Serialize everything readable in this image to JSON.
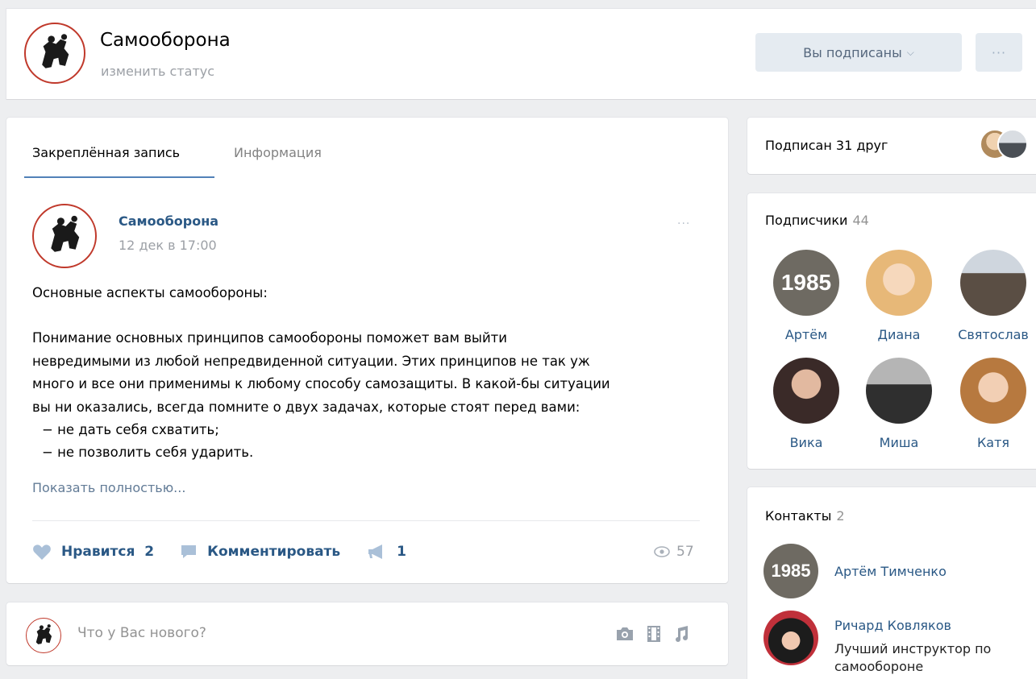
{
  "header": {
    "title": "Самооборона",
    "status": "изменить статус",
    "subscribed_label": "Вы подписаны",
    "more_label": "···"
  },
  "tabs": [
    {
      "label": "Закреплённая запись",
      "active": true
    },
    {
      "label": "Информация",
      "active": false
    }
  ],
  "post": {
    "author": "Самооборона",
    "date": "12 дек в 17:00",
    "more_label": "···",
    "lines": [
      "Основные аспекты самообороны:",
      "",
      "Понимание основных принципов самообороны поможет вам выйти",
      "невредимыми из любой непредвиденной ситуации. Этих принципов не так уж",
      "много и все они применимы к любому способу самозащиты. В какой-бы ситуации",
      "вы ни оказались, всегда помните о двух задачах, которые стоят перед вами:",
      "− не дать себя схватить;",
      "− не позволить себя ударить."
    ],
    "show_more": "Показать полностью...",
    "like_label": "Нравится",
    "like_count": "2",
    "comment_label": "Комментировать",
    "share_count": "1",
    "views": "57"
  },
  "new_post": {
    "placeholder": "Что у Вас нового?"
  },
  "friends": {
    "label": "Подписан 31 друг"
  },
  "subscribers": {
    "label": "Подписчики",
    "count": "44",
    "items": [
      {
        "name": "Артём"
      },
      {
        "name": "Диана"
      },
      {
        "name": "Святослав"
      },
      {
        "name": "Вика"
      },
      {
        "name": "Миша"
      },
      {
        "name": "Катя"
      }
    ]
  },
  "contacts": {
    "label": "Контакты",
    "count": "2",
    "items": [
      {
        "name": "Артём Тимченко",
        "desc": ""
      },
      {
        "name": "Ричард Ковляков",
        "desc": "Лучший инструктор по самообороне"
      }
    ]
  },
  "avatar_badge_text": "1985",
  "colors": {
    "link": "#2a5885",
    "muted": "#9ca0a6",
    "button_bg": "#e5ebf1",
    "tab_underline": "#5181b8",
    "logo_ring": "#c0392b"
  }
}
